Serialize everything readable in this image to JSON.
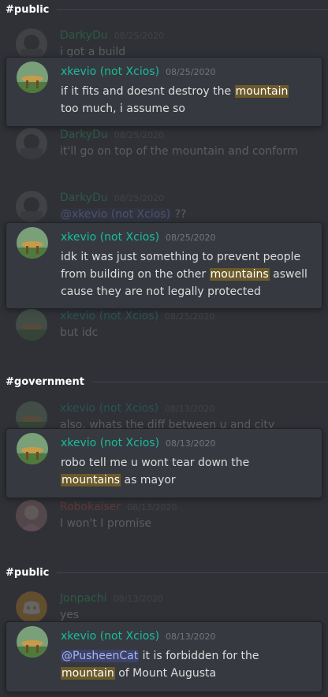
{
  "sections": [
    {
      "label": "#public"
    },
    {
      "label": "#government"
    },
    {
      "label": "#public"
    }
  ],
  "faded": [
    {
      "author": "DarkyDu",
      "ts": "08/25/2020",
      "text": "i got a build"
    },
    {
      "author": "DarkyDu",
      "ts": "08/25/2020",
      "text": "it'll go on top of the mountain and conform"
    },
    {
      "author": "DarkyDu",
      "ts": "08/25/2020",
      "mention": "@xkevio (not Xcios)",
      "text": " ??"
    },
    {
      "author": "xkevio (not Xcios)",
      "ts": "08/25/2020",
      "text": "but idc"
    },
    {
      "author": "xkevio (not Xcios)",
      "ts": "08/13/2020",
      "text": "also, whats the diff between u and city"
    },
    {
      "author": "Robokaiser",
      "ts": "08/13/2020",
      "text": "I won't I promise"
    },
    {
      "author": "Jonpachi",
      "ts": "08/13/2020",
      "text": "yes"
    }
  ],
  "cards": [
    {
      "author": "xkevio (not Xcios)",
      "ts": "08/25/2020",
      "pre": "if it fits and doesnt destroy the ",
      "hl": "mountain",
      "post": " too much, i assume so"
    },
    {
      "author": "xkevio (not Xcios)",
      "ts": "08/25/2020",
      "pre": "idk it was just something to prevent people from building on the other ",
      "hl": "mountains",
      "post": " aswell cause they are not legally protected"
    },
    {
      "author": "xkevio (not Xcios)",
      "ts": "08/13/2020",
      "pre": "robo tell me u wont tear down the ",
      "hl": "mountains",
      "post": " as mayor"
    },
    {
      "author": "xkevio (not Xcios)",
      "ts": "08/13/2020",
      "mention": "@PusheenCat",
      "pre": " it is forbidden for the ",
      "hl": "mountain",
      "post": " of Mount Augusta"
    }
  ],
  "colors": {
    "background": "#2f3136",
    "card": "#36393f",
    "highlight": "#6b5a2a",
    "author_green": "#1abc9c"
  }
}
